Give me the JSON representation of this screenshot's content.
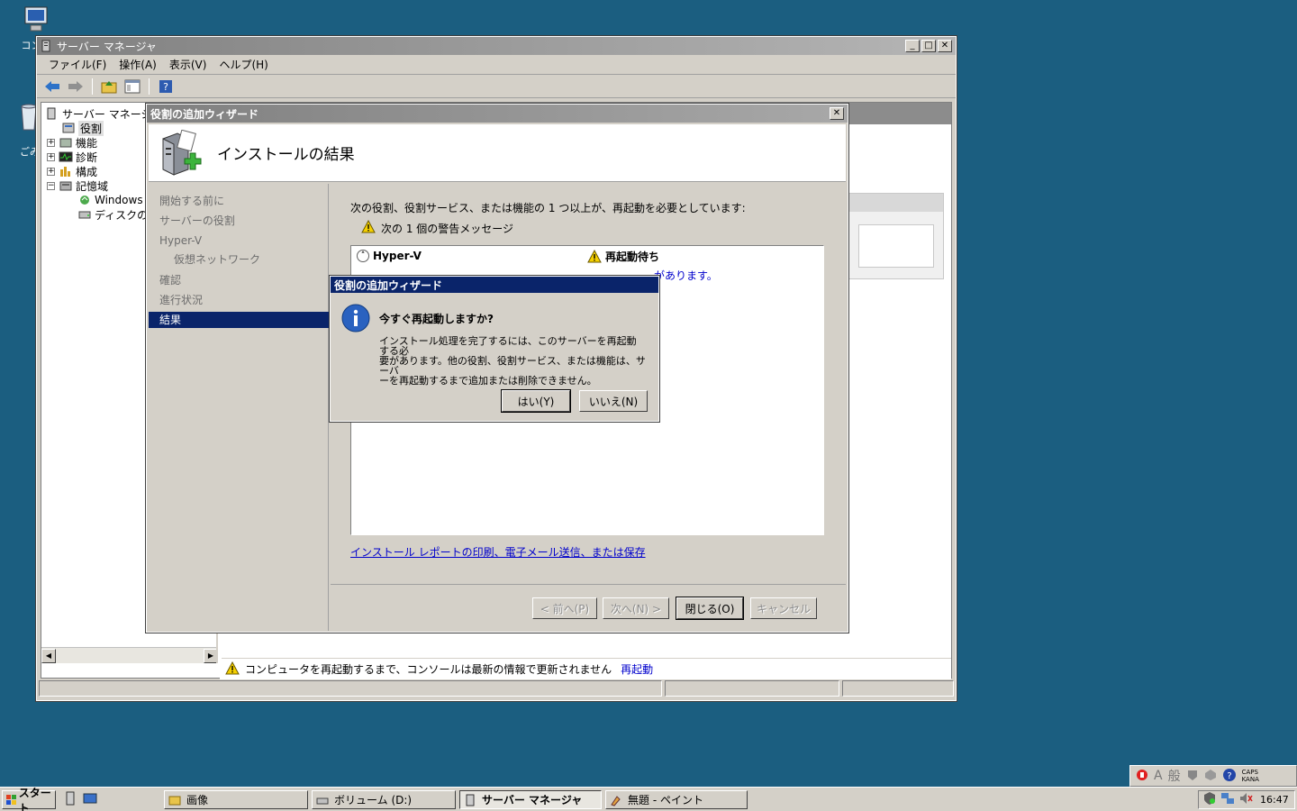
{
  "desktop": {
    "icons": [
      {
        "label": "コンピ"
      },
      {
        "label": "ごみ"
      }
    ]
  },
  "server_manager": {
    "title": "サーバー マネージャ",
    "menu": [
      "ファイル(F)",
      "操作(A)",
      "表示(V)",
      "ヘルプ(H)"
    ],
    "tree": {
      "root": "サーバー マネージャ",
      "items": [
        "役割",
        "機能",
        "診断",
        "構成",
        "記憶域"
      ],
      "storage_children": [
        "Windows S",
        "ディスクの管"
      ]
    },
    "notification": {
      "message": "コンピュータを再起動するまで、コンソールは最新の情報で更新されません",
      "link": "再起動"
    }
  },
  "wizard": {
    "title": "役割の追加ウィザード",
    "header_title": "インストールの結果",
    "nav": [
      "開始する前に",
      "サーバーの役割",
      "Hyper-V",
      "仮想ネットワーク",
      "確認",
      "進行状況",
      "結果"
    ],
    "intro_text": "次の役割、役割サービス、または機能の 1 つ以上が、再起動を必要としています:",
    "warning_count": "次の 1 個の警告メッセージ",
    "results": {
      "role": "Hyper-V",
      "status": "再起動待ち",
      "detail_tail": "があります。"
    },
    "report_link": "インストール レポートの印刷、電子メール送信、または保存",
    "buttons": {
      "prev": "< 前へ(P)",
      "next": "次へ(N) >",
      "close": "閉じる(O)",
      "cancel": "キャンセル"
    }
  },
  "dialog": {
    "title": "役割の追加ウィザード",
    "question": "今すぐ再起動しますか?",
    "message_lines": [
      "インストール処理を完了するには、このサーバーを再起動する必",
      "要があります。他の役割、役割サービス、または機能は、サーバ",
      "ーを再起動するまで追加または削除できません。"
    ],
    "yes": "はい(Y)",
    "no": "いいえ(N)"
  },
  "taskbar": {
    "start": "スタート",
    "tasks": [
      "画像",
      "ボリューム (D:)",
      "サーバー マネージャ",
      "無題 - ペイント"
    ],
    "active_task": "サーバー マネージャ",
    "ime": [
      "A",
      "般"
    ],
    "caps": [
      "CAPS",
      "KANA"
    ],
    "clock": "16:47"
  },
  "colors": {
    "desktop": "#1b5e80",
    "active_title": "#0a246a",
    "link": "#0000cc",
    "warning": "#f5d000"
  }
}
